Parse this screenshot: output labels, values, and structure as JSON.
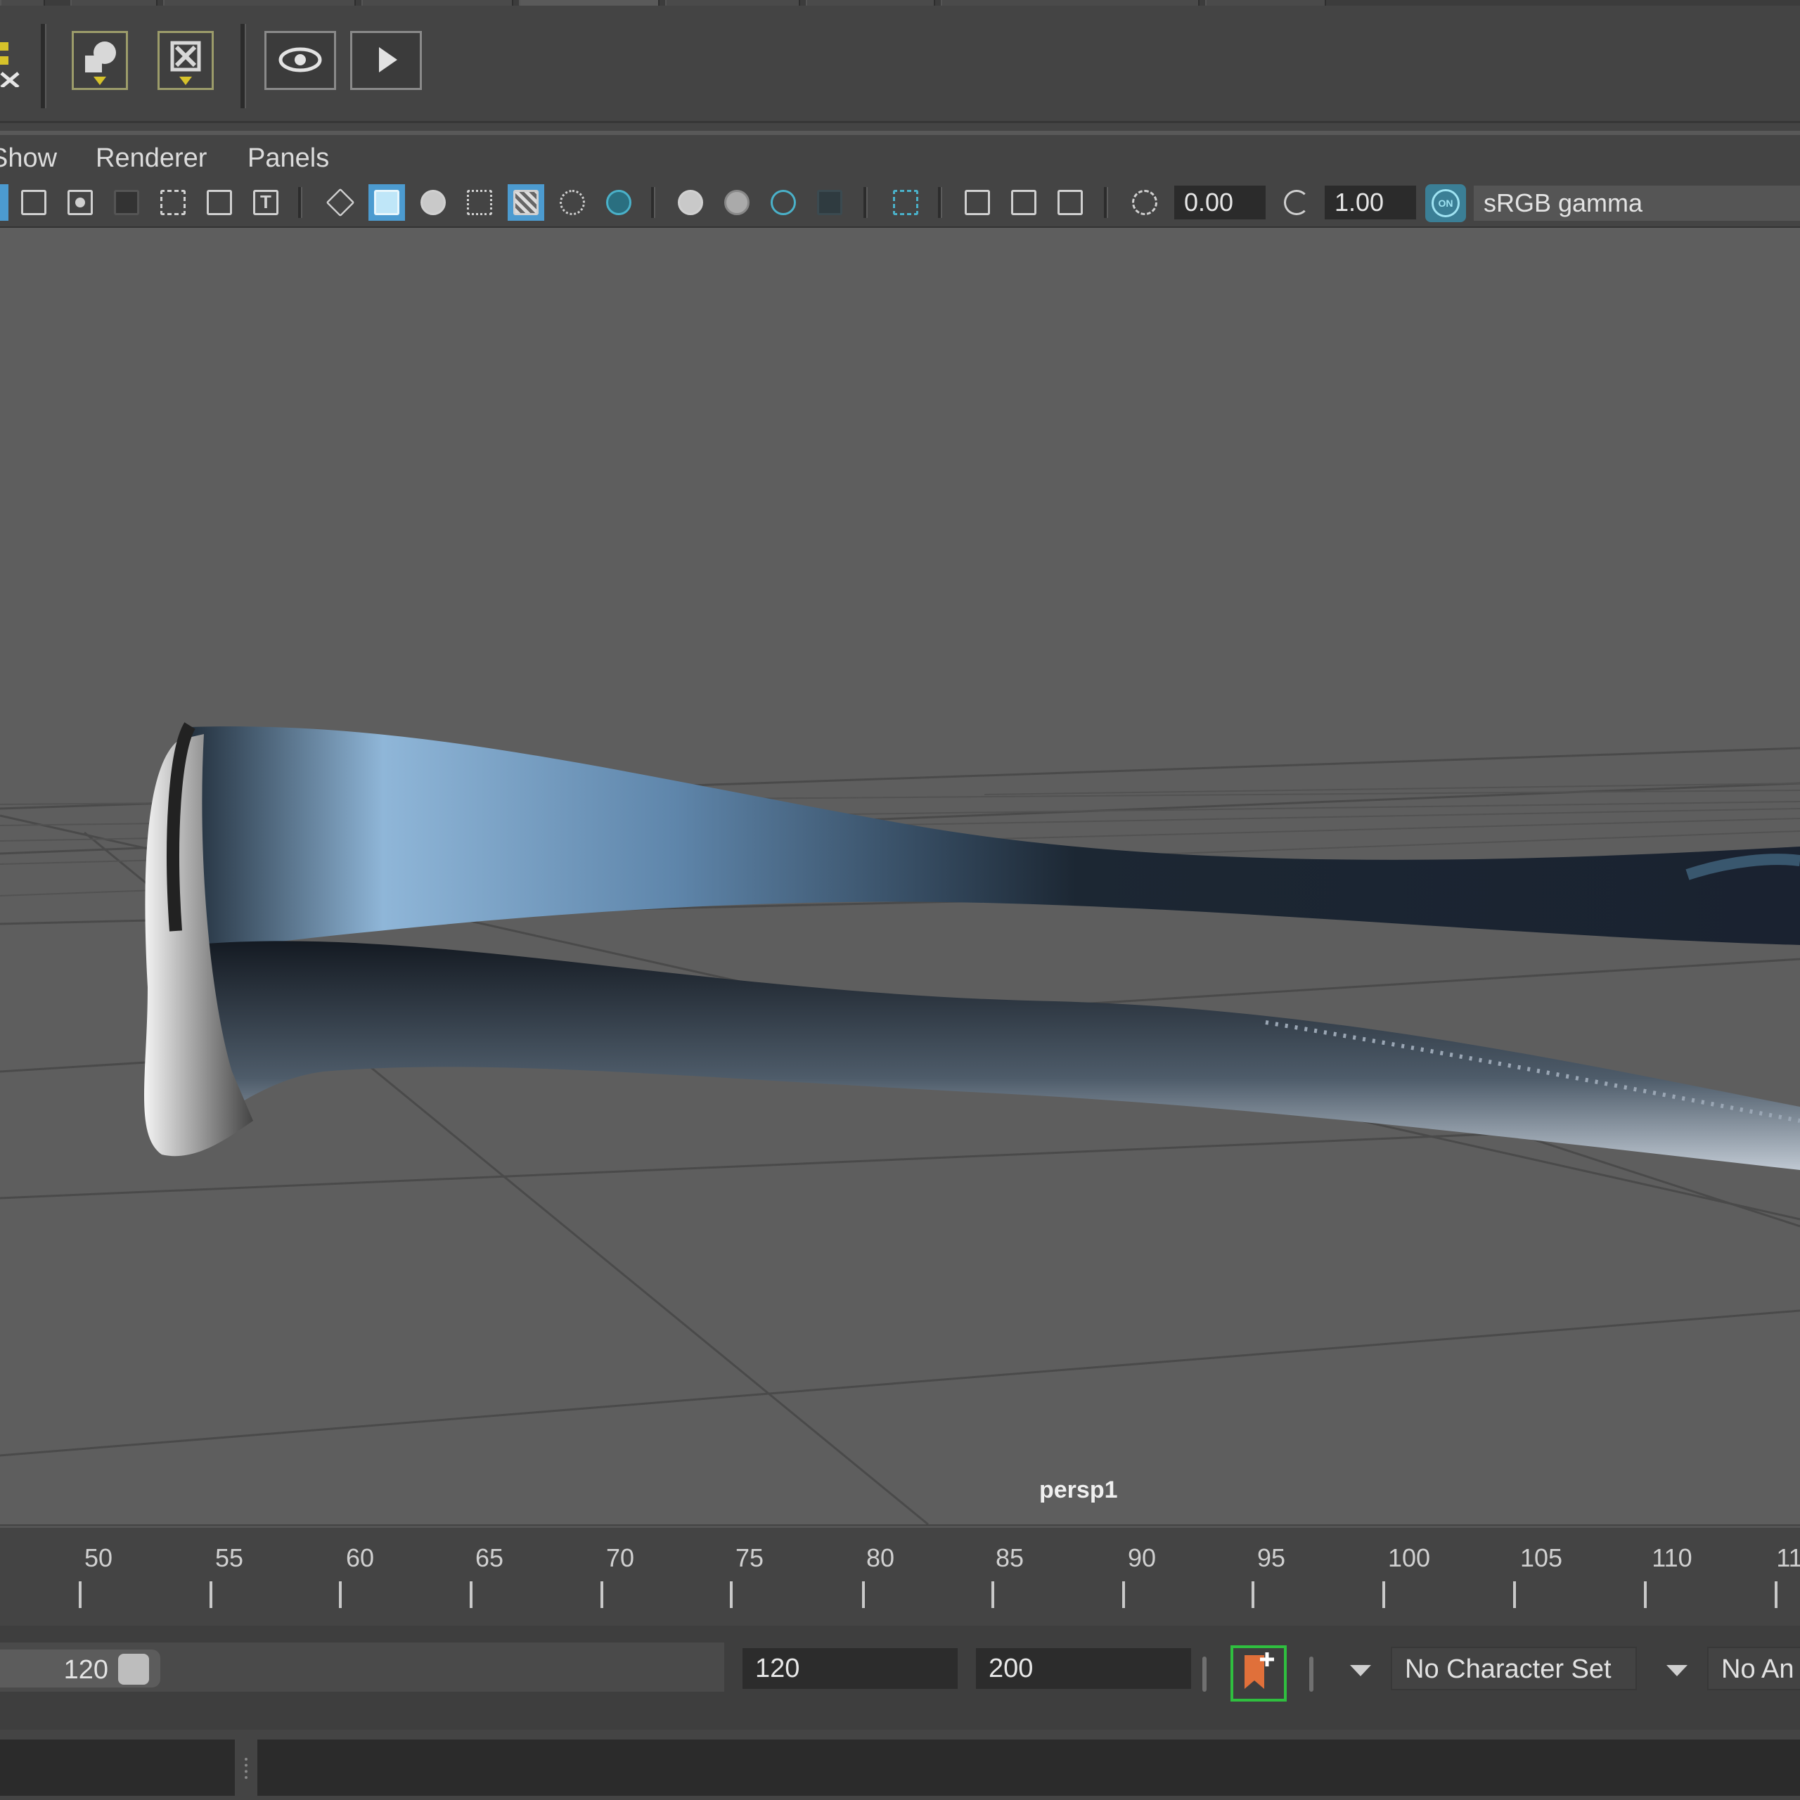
{
  "panel_menu": {
    "show": "Show",
    "renderer": "Renderer",
    "panels": "Panels"
  },
  "toolbar": {
    "exposure_value": "0.00",
    "gamma_value": "1.00",
    "color_management_badge": "ON",
    "color_space": "sRGB gamma"
  },
  "viewport": {
    "camera_name": "persp1"
  },
  "timeline": {
    "ticks": [
      "50",
      "55",
      "60",
      "65",
      "70",
      "75",
      "80",
      "85",
      "90",
      "95",
      "100",
      "105",
      "110",
      "11"
    ]
  },
  "range_slider": {
    "range_end_value": "120",
    "end_time": "120",
    "anim_end_time": "200",
    "character_set": "No Character Set",
    "anim_layer": "No An"
  },
  "colors": {
    "accent": "#4c9bd0",
    "keyframe_green": "#2fbf3f",
    "bookmark_orange": "#e0703a",
    "viewport_bg": "#5e5e5e"
  }
}
